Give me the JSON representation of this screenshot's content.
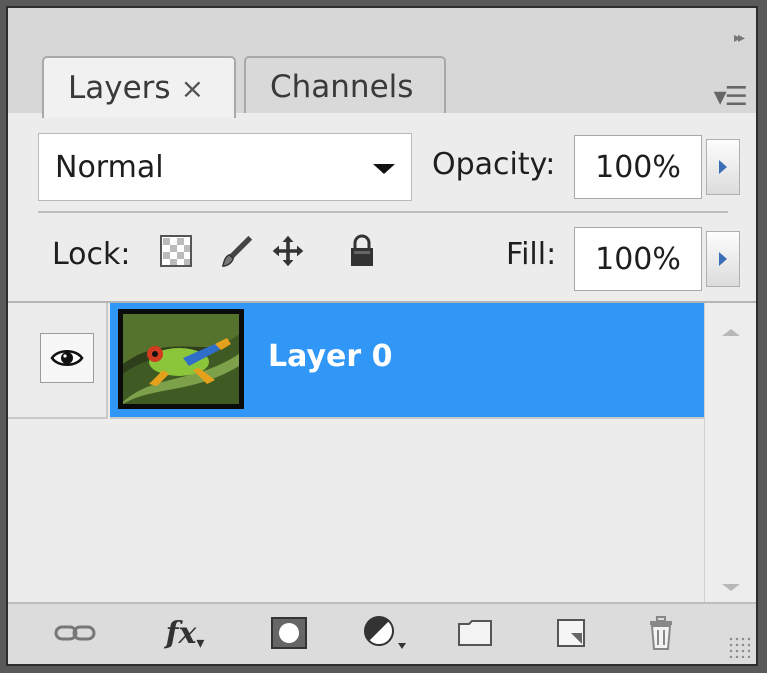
{
  "panel": {
    "tabs": [
      {
        "label": "Layers",
        "close_glyph": "×",
        "active": true
      },
      {
        "label": "Channels",
        "active": false
      }
    ],
    "collapse_glyph": "▸▸",
    "menu_glyph": "▾☰"
  },
  "controls": {
    "blend_mode": "Normal",
    "opacity_label": "Opacity:",
    "opacity_value": "100%",
    "lock_label": "Lock:",
    "fill_label": "Fill:",
    "fill_value": "100%"
  },
  "layers": [
    {
      "name": "Layer 0",
      "visible": true,
      "selected": true
    }
  ],
  "colors": {
    "selection": "#3197f6",
    "panel_bg": "#ececec"
  },
  "bottom_icons": [
    "link-layers-icon",
    "fx-icon",
    "layer-mask-icon",
    "adjustment-layer-icon",
    "new-group-icon",
    "new-layer-icon",
    "delete-layer-icon"
  ]
}
